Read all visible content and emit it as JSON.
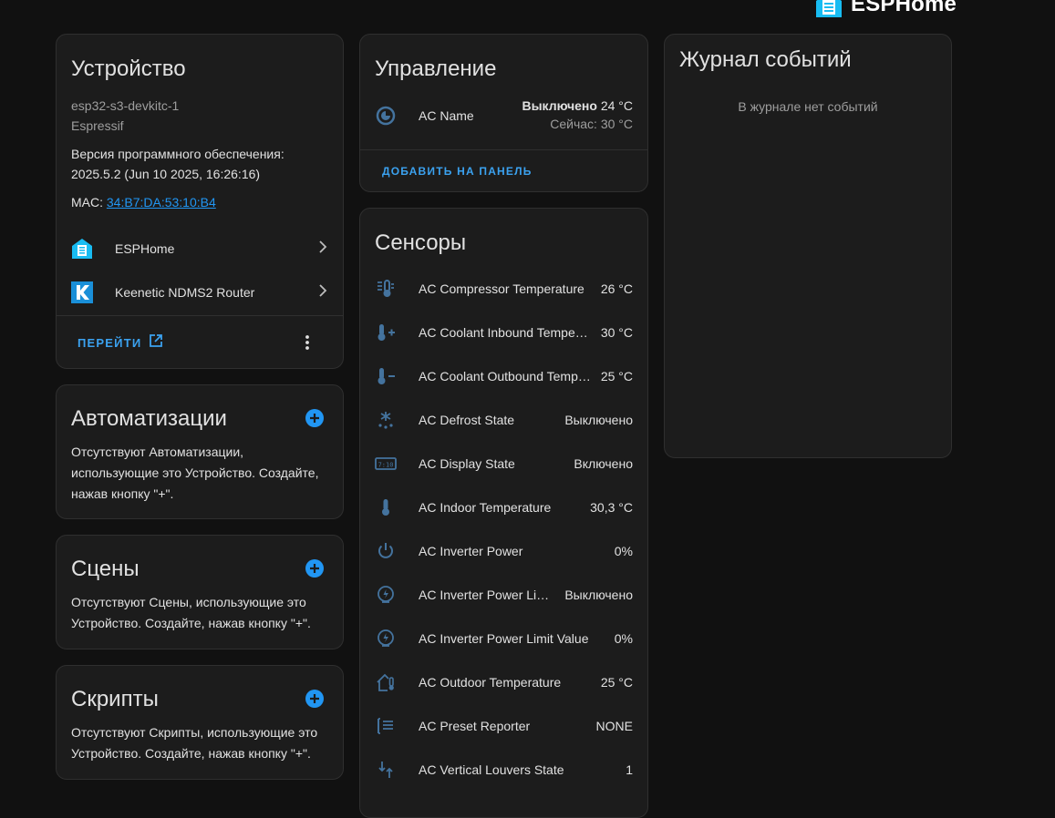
{
  "header": {
    "brand": "ESPHome"
  },
  "device_card": {
    "title": "Устройство",
    "model": "esp32-s3-devkitc-1",
    "manufacturer": "Espressif",
    "firmware_label": "Версия программного обеспечения:",
    "firmware_value": "2025.5.2 (Jun 10 2025, 16:26:16)",
    "mac_label": "MAC: ",
    "mac_value": "34:B7:DA:53:10:B4",
    "integrations": [
      {
        "label": "ESPHome",
        "icon": "esphome-icon"
      },
      {
        "label": "Keenetic NDMS2 Router",
        "icon": "keenetic-icon"
      }
    ],
    "visit_label": "Перейти"
  },
  "automations_card": {
    "title": "Автоматизации",
    "text": "Отсутствуют Автоматизации, использующие это Устройство. Создайте, нажав кнопку \"+\"."
  },
  "scenes_card": {
    "title": "Сцены",
    "text": "Отсутствуют Сцены, использующие это Устройство. Создайте, нажав кнопку \"+\"."
  },
  "scripts_card": {
    "title": "Скрипты",
    "text": "Отсутствуют Скрипты, использующие это Устройство. Создайте, нажав кнопку \"+\"."
  },
  "controls_card": {
    "title": "Управление",
    "entity_name": "AC Name",
    "state": "Выключено",
    "target_temp": "24 °C",
    "current_temp": "Сейчас: 30 °C",
    "add_to_dashboard": "Добавить на панель"
  },
  "sensors_card": {
    "title": "Сенсоры",
    "items": [
      {
        "name": "AC Compressor Temperature",
        "value": "26 °C",
        "icon": "thermometer-lines-icon"
      },
      {
        "name": "AC Coolant Inbound Temperature",
        "value": "30 °C",
        "icon": "thermometer-plus-icon"
      },
      {
        "name": "AC Coolant Outbound Temperature",
        "value": "25 °C",
        "icon": "thermometer-minus-icon"
      },
      {
        "name": "AC Defrost State",
        "value": "Выключено",
        "icon": "snowflake-melt-icon"
      },
      {
        "name": "AC Display State",
        "value": "Включено",
        "icon": "clock-digital-icon"
      },
      {
        "name": "AC Indoor Temperature",
        "value": "30,3 °C",
        "icon": "thermometer-icon"
      },
      {
        "name": "AC Inverter Power",
        "value": "0%",
        "icon": "power-icon"
      },
      {
        "name": "AC Inverter Power Limit State",
        "value": "Выключено",
        "icon": "gauge-flash-icon"
      },
      {
        "name": "AC Inverter Power Limit Value",
        "value": "0%",
        "icon": "gauge-flash-icon"
      },
      {
        "name": "AC Outdoor Temperature",
        "value": "25 °C",
        "icon": "home-thermometer-icon"
      },
      {
        "name": "AC Preset Reporter",
        "value": "NONE",
        "icon": "format-list-icon"
      },
      {
        "name": "AC Vertical Louvers State",
        "value": "1",
        "icon": "swap-vertical-icon"
      }
    ]
  },
  "logbook_card": {
    "title": "Журнал событий",
    "empty_text": "В журнале нет событий"
  },
  "colors": {
    "background": "#111111",
    "card": "#1c1c1c",
    "accent": "#2196f3",
    "icon": "#44739e",
    "text": "#e1e1e1",
    "muted": "#9e9e9e"
  }
}
